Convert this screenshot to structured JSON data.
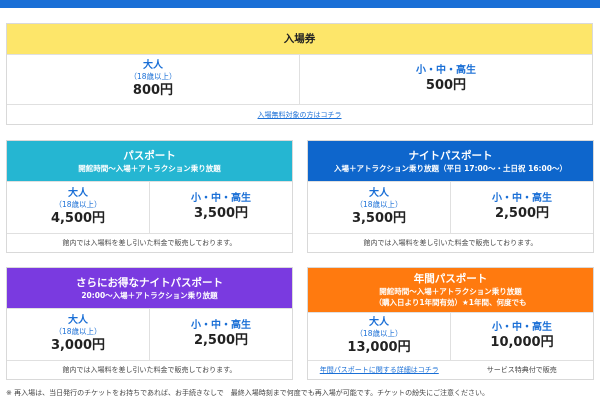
{
  "colors": {
    "top_bar": "#1a6fd6",
    "admission_header": "#fde66a",
    "passport_header": "#25b6d2",
    "night_header": "#0e66cc",
    "deal_header": "#7a3ae0",
    "annual_header": "#ff7a0f",
    "link": "#1a6fd6"
  },
  "admission": {
    "title": "入場券",
    "adult_label": "大人",
    "adult_age": "（18歳以上）",
    "adult_price": "800円",
    "student_label": "小・中・高生",
    "student_price": "500円",
    "link": "入場無料対象の方はコチラ"
  },
  "passport": {
    "title": "パスポート",
    "subtitle": "開館時間〜入場＋アトラクション乗り放題",
    "adult_label": "大人",
    "adult_age": "（18歳以上）",
    "adult_price": "4,500円",
    "student_label": "小・中・高生",
    "student_price": "3,500円",
    "note": "館内では入場料を差し引いた料金で販売しております。"
  },
  "night": {
    "title": "ナイトパスポート",
    "subtitle": "入場＋アトラクション乗り放題（平日 17:00〜・土日祝 16:00〜）",
    "adult_label": "大人",
    "adult_age": "（18歳以上）",
    "adult_price": "3,500円",
    "student_label": "小・中・高生",
    "student_price": "2,500円",
    "note": "館内では入場料を差し引いた料金で販売しております。"
  },
  "deal": {
    "title": "さらにお得なナイトパスポート",
    "subtitle": "20:00〜入場＋アトラクション乗り放題",
    "adult_label": "大人",
    "adult_age": "（18歳以上）",
    "adult_price": "3,000円",
    "student_label": "小・中・高生",
    "student_price": "2,500円",
    "note": "館内では入場料を差し引いた料金で販売しております。"
  },
  "annual": {
    "title": "年間パスポート",
    "subtitle1": "開館時間〜入場＋アトラクション乗り放題",
    "subtitle2": "（購入日より1年間有効）★1年間、何度でも",
    "adult_label": "大人",
    "adult_age": "（18歳以上）",
    "adult_price": "13,000円",
    "student_label": "小・中・高生",
    "student_price": "10,000円",
    "link": "年間パスポートに関する詳細はコチラ",
    "note": "サービス特典付で販売"
  },
  "footer": "※ 再入場は、当日発行のチケットをお持ちであれば、お手続きなしで　最終入場時刻まで何度でも再入場が可能です。チケットの紛失にご注意ください。"
}
